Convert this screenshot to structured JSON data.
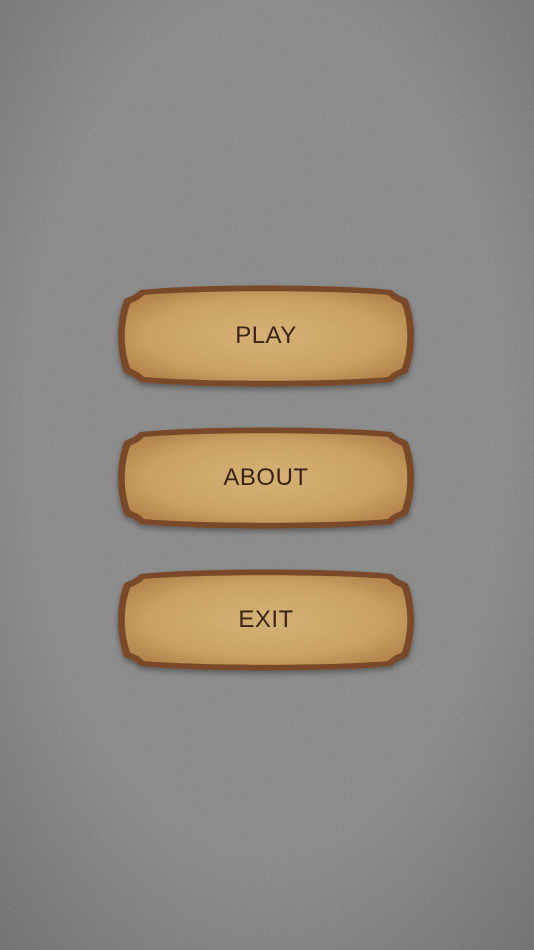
{
  "menu": {
    "buttons": [
      {
        "label": "PLAY"
      },
      {
        "label": "ABOUT"
      },
      {
        "label": "EXIT"
      }
    ]
  },
  "colors": {
    "background": "#808080",
    "plank_fill": "#d6ad6c",
    "plank_border": "#7a4a2a",
    "label_text": "#3a2416"
  }
}
